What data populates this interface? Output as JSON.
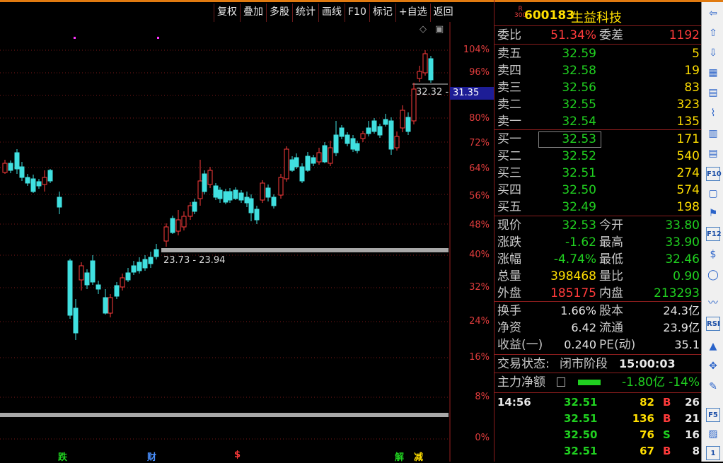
{
  "toolbar": {
    "items": [
      "复权",
      "叠加",
      "多股",
      "统计",
      "画线",
      "F10",
      "标记",
      "+自选",
      "返回"
    ]
  },
  "chart": {
    "pct_labels": [
      "104%",
      "96%",
      "88%",
      "80%",
      "72%",
      "64%",
      "56%",
      "48%",
      "40%",
      "32%",
      "24%",
      "16%",
      "8%",
      "0%"
    ],
    "last_price_tag": "31.35",
    "high_range_label": "32.32 -",
    "low_range_label": "23.73 - 23.94",
    "markers": [
      "跌",
      "财",
      "$",
      "解",
      "减"
    ],
    "chart_icon_1": "diamond-icon",
    "chart_icon_2": "window-icon"
  },
  "quote": {
    "badge_top": "R",
    "badge_bottom": "300",
    "code": "600183",
    "name": "生益科技",
    "weibi_label": "委比",
    "weibi": "51.34%",
    "weicha_label": "委差",
    "weicha": "1192",
    "asks": [
      {
        "label": "卖五",
        "price": "32.59",
        "vol": "5"
      },
      {
        "label": "卖四",
        "price": "32.58",
        "vol": "19"
      },
      {
        "label": "卖三",
        "price": "32.56",
        "vol": "83"
      },
      {
        "label": "卖二",
        "price": "32.55",
        "vol": "323"
      },
      {
        "label": "卖一",
        "price": "32.54",
        "vol": "135"
      }
    ],
    "bids": [
      {
        "label": "买一",
        "price": "32.53",
        "vol": "171"
      },
      {
        "label": "买二",
        "price": "32.52",
        "vol": "540"
      },
      {
        "label": "买三",
        "price": "32.51",
        "vol": "274"
      },
      {
        "label": "买四",
        "price": "32.50",
        "vol": "574"
      },
      {
        "label": "买五",
        "price": "32.49",
        "vol": "198"
      }
    ],
    "stats": [
      {
        "l1": "现价",
        "v1": "32.53",
        "c1": "green",
        "l2": "今开",
        "v2": "33.80",
        "c2": "green"
      },
      {
        "l1": "涨跌",
        "v1": "-1.62",
        "c1": "green",
        "l2": "最高",
        "v2": "33.90",
        "c2": "green"
      },
      {
        "l1": "涨幅",
        "v1": "-4.74%",
        "c1": "green",
        "l2": "最低",
        "v2": "32.46",
        "c2": "green"
      },
      {
        "l1": "总量",
        "v1": "398468",
        "c1": "yellow",
        "l2": "量比",
        "v2": "0.90",
        "c2": "green"
      },
      {
        "l1": "外盘",
        "v1": "185175",
        "c1": "red",
        "l2": "内盘",
        "v2": "213293",
        "c2": "green"
      }
    ],
    "stats2": [
      {
        "l1": "换手",
        "v1": "1.66%",
        "l2": "股本",
        "v2": "24.3亿"
      },
      {
        "l1": "净资",
        "v1": "6.42",
        "l2": "流通",
        "v2": "23.9亿"
      },
      {
        "l1": "收益(一)",
        "v1": "0.240",
        "l2": "PE(动)",
        "v2": "35.1"
      }
    ],
    "trade_status_label": "交易状态:",
    "trade_status": "闭市阶段",
    "trade_time": "15:00:03",
    "main_force_label": "主力净额",
    "main_force_value": "-1.80亿",
    "main_force_pct": "-14%"
  },
  "ticks": [
    {
      "time": "14:56",
      "price": "32.51",
      "vol": "82",
      "bs": "B",
      "n": "26"
    },
    {
      "time": "",
      "price": "32.51",
      "vol": "136",
      "bs": "B",
      "n": "21"
    },
    {
      "time": "",
      "price": "32.50",
      "vol": "76",
      "bs": "S",
      "n": "16"
    },
    {
      "time": "",
      "price": "32.51",
      "vol": "67",
      "bs": "B",
      "n": "8"
    }
  ],
  "sidebar": [
    "arrow-left-icon",
    "arrow-up-icon",
    "arrow-down-icon",
    "chart-grid-icon",
    "list-icon",
    "line-chart-icon",
    "kline-icon",
    "table-icon",
    "f10-icon",
    "detail-icon",
    "flag-icon",
    "f12-icon",
    "dollar-icon",
    "circle-icon",
    "wave-icon",
    "rsi-icon",
    "up-icon",
    "move-icon",
    "pencil-icon",
    "f5-icon",
    "layout-icon",
    "number-one-icon"
  ],
  "sidebar_text": {
    "f10": "F10",
    "f12": "F12",
    "rsi": "RSI",
    "f5": "F5",
    "one": "1"
  },
  "colors": {
    "up": "#ff3b3b",
    "down": "#40e0e0",
    "bg": "#000000",
    "grid": "#8a1d1d"
  }
}
